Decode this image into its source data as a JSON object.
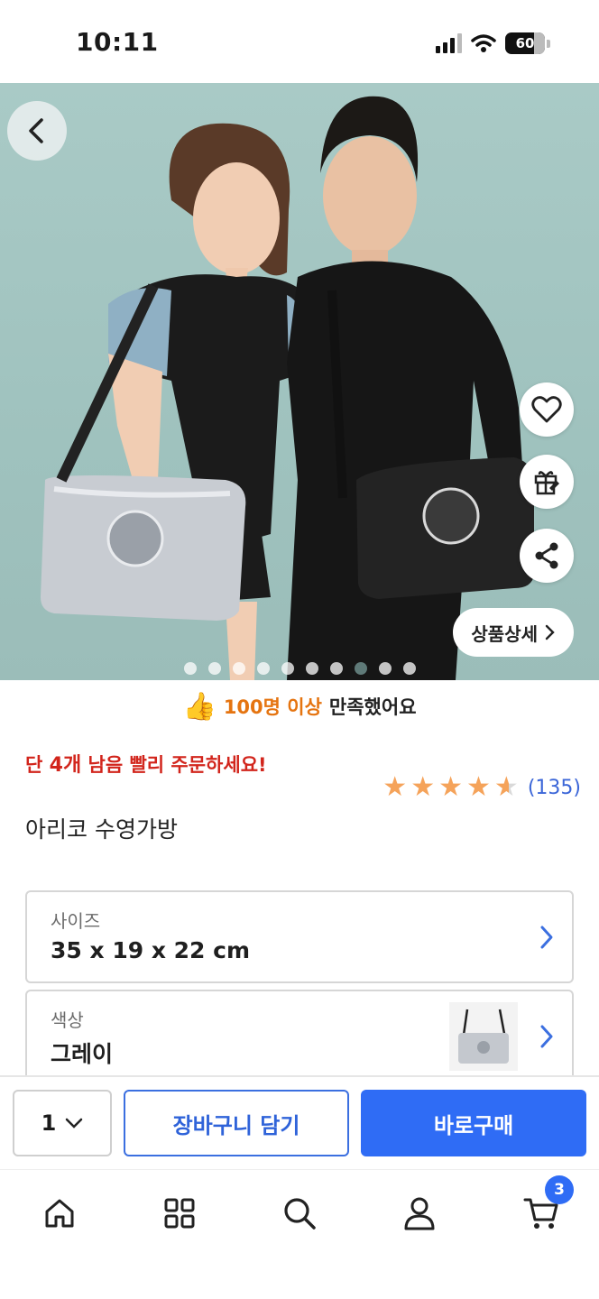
{
  "status_bar": {
    "time": "10:11",
    "battery": "60",
    "icons": [
      "signal-icon",
      "wifi-icon",
      "battery-icon"
    ]
  },
  "hero": {
    "back_icon": "chevron-left-icon",
    "side_actions": [
      {
        "name": "wishlist",
        "icon": "heart-icon"
      },
      {
        "name": "gift",
        "icon": "gift-icon"
      },
      {
        "name": "share",
        "icon": "share-icon"
      }
    ],
    "detail_label": "상품상세",
    "carousel": {
      "total": 10,
      "active": 8
    }
  },
  "satisfaction": {
    "icon": "thumbs-up-icon",
    "count": "100명 이상",
    "rest": "만족했어요"
  },
  "urgent": {
    "prefix": "단 ",
    "count": "4개",
    "suffix": " 남음 빨리 주문하세요!"
  },
  "rating": {
    "value": 4.5,
    "max": 5,
    "count": "(135)"
  },
  "product": {
    "name": "아리코 수영가방"
  },
  "options": [
    {
      "label": "사이즈",
      "value": "35 x 19 x 22 cm"
    },
    {
      "label": "색상",
      "value": "그레이"
    }
  ],
  "purchase": {
    "quantity": "1",
    "cart_label": "장바구니 담기",
    "buy_label": "바로구매"
  },
  "bottom_nav": {
    "items": [
      "home-icon",
      "categories-icon",
      "search-icon",
      "profile-icon",
      "cart-icon"
    ],
    "cart_count": "3"
  },
  "colors": {
    "accent": "#2f6cf5",
    "urgent": "#d2251c",
    "star": "#f5a35a",
    "highlight": "#e57410"
  }
}
